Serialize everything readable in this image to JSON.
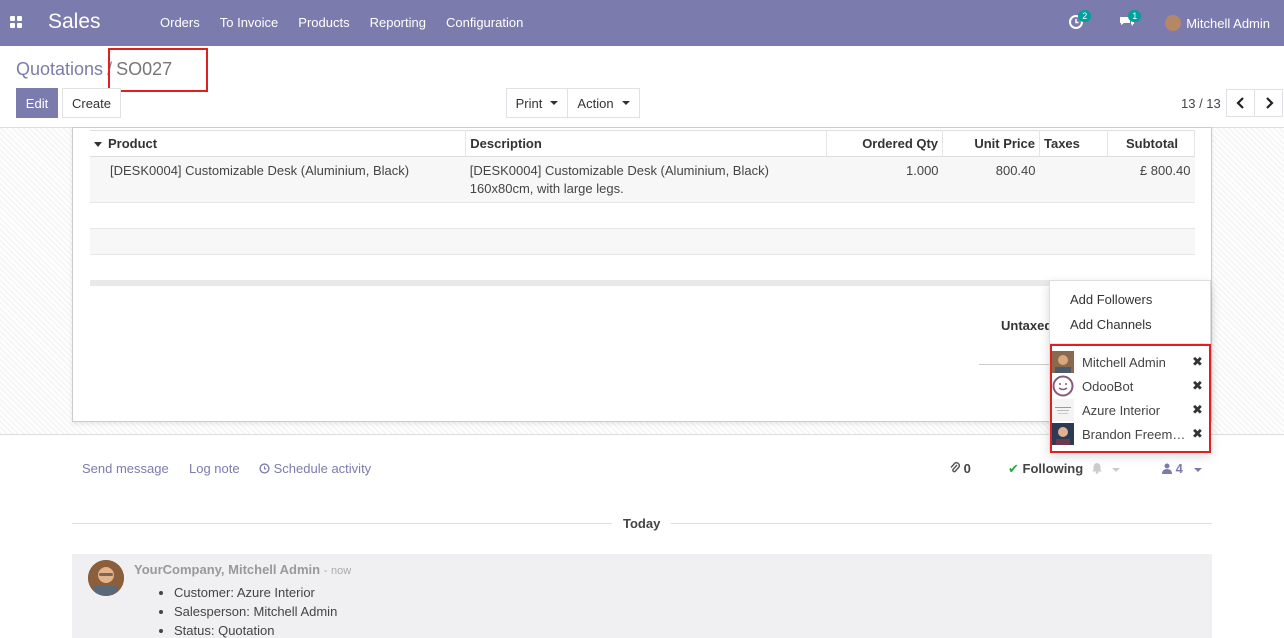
{
  "navbar": {
    "app_name": "Sales",
    "menu": [
      "Orders",
      "To Invoice",
      "Products",
      "Reporting",
      "Configuration"
    ],
    "activity_count": "2",
    "message_count": "1",
    "user_name": "Mitchell Admin"
  },
  "control_panel": {
    "breadcrumb_parent": "Quotations",
    "breadcrumb_separator": "/",
    "breadcrumb_current": "SO027",
    "edit_label": "Edit",
    "create_label": "Create",
    "print_label": "Print",
    "action_label": "Action",
    "pager": "13 / 13"
  },
  "order_lines": {
    "headers": [
      "Product",
      "Description",
      "Ordered Qty",
      "Unit Price",
      "Taxes",
      "Subtotal"
    ],
    "rows": [
      {
        "product": "[DESK0004] Customizable Desk (Aluminium, Black)",
        "description_1": "[DESK0004] Customizable Desk (Aluminium, Black)",
        "description_2": "160x80cm, with large legs.",
        "qty": "1.000",
        "unit_price": "800.40",
        "taxes": "",
        "subtotal": "£ 800.40"
      }
    ],
    "untaxed_label": "Untaxed"
  },
  "followers_dropdown": {
    "add_followers": "Add Followers",
    "add_channels": "Add Channels",
    "followers": [
      {
        "name": "Mitchell Admin"
      },
      {
        "name": "OdooBot"
      },
      {
        "name": "Azure Interior"
      },
      {
        "name": "Brandon Freeman"
      }
    ]
  },
  "chatter": {
    "send_message": "Send message",
    "log_note": "Log note",
    "schedule_activity": "Schedule activity",
    "attachments": "0",
    "following": "Following",
    "followers_count": "4",
    "today": "Today",
    "message": {
      "author": "YourCompany, Mitchell Admin",
      "time": "now",
      "items": [
        "Customer: Azure Interior",
        "Salesperson: Mitchell Admin",
        "Status: Quotation"
      ]
    }
  },
  "colors": {
    "brand": "#7c7bad",
    "highlight": "#e02020",
    "success": "#28a745",
    "badge": "#00a09d"
  }
}
